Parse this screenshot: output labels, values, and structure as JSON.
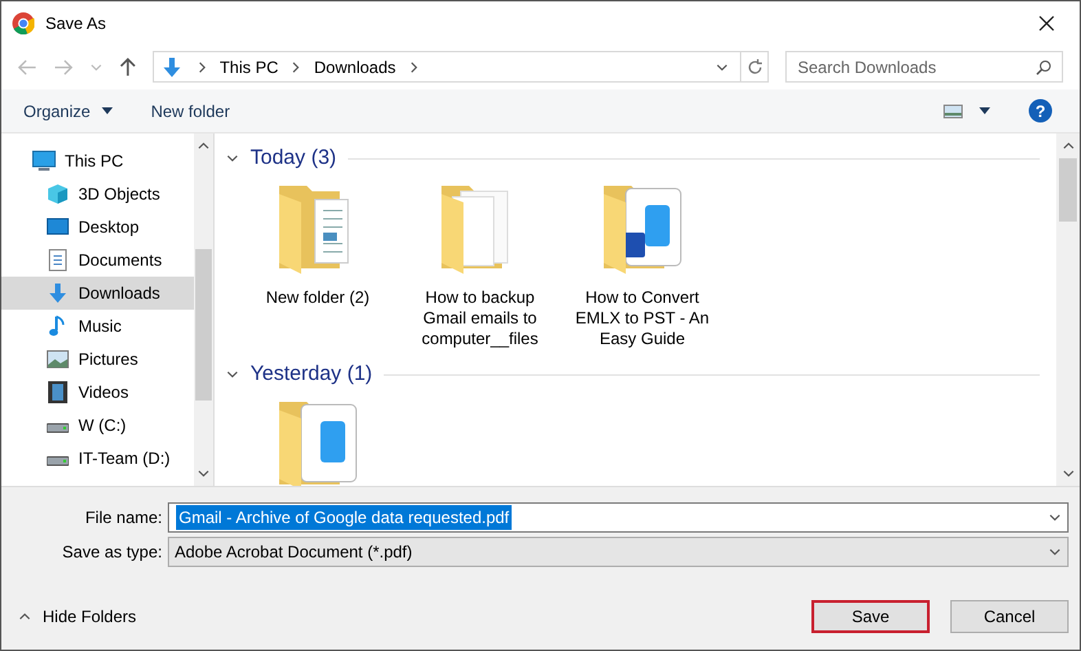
{
  "window": {
    "title": "Save As"
  },
  "breadcrumb": [
    "This PC",
    "Downloads"
  ],
  "search": {
    "placeholder": "Search Downloads"
  },
  "toolbar": {
    "organize": "Organize",
    "new_folder": "New folder",
    "help": "?"
  },
  "sidebar": {
    "items": [
      {
        "label": "This PC",
        "kind": "pc",
        "selected": false,
        "children": [
          {
            "label": "3D Objects",
            "kind": "cube",
            "selected": false
          },
          {
            "label": "Desktop",
            "kind": "desktop",
            "selected": false
          },
          {
            "label": "Documents",
            "kind": "document",
            "selected": false
          },
          {
            "label": "Downloads",
            "kind": "download",
            "selected": true
          },
          {
            "label": "Music",
            "kind": "music",
            "selected": false
          },
          {
            "label": "Pictures",
            "kind": "picture",
            "selected": false
          },
          {
            "label": "Videos",
            "kind": "video",
            "selected": false
          },
          {
            "label": "W (C:)",
            "kind": "drive",
            "selected": false
          },
          {
            "label": "IT-Team (D:)",
            "kind": "drive",
            "selected": false
          }
        ]
      }
    ]
  },
  "groups": [
    {
      "title": "Today (3)",
      "expanded": true,
      "files": [
        {
          "name": "New folder (2)",
          "kind": "pages"
        },
        {
          "name": "How to backup Gmail emails to computer__files",
          "kind": "blank"
        },
        {
          "name": "How to Convert EMLX to PST - An Easy Guide",
          "kind": "word"
        }
      ]
    },
    {
      "title": "Yesterday (1)",
      "expanded": true,
      "files": [
        {
          "kind": "doc"
        }
      ]
    }
  ],
  "form": {
    "file_name_label": "File name:",
    "file_name": "Gmail - Archive of Google data requested.pdf",
    "type_label": "Save as type:",
    "type": "Adobe Acrobat Document (*.pdf)"
  },
  "hide_folders": "Hide Folders",
  "buttons": [
    {
      "label": "Save",
      "selected": true
    },
    {
      "label": "Cancel",
      "selected": false
    }
  ]
}
